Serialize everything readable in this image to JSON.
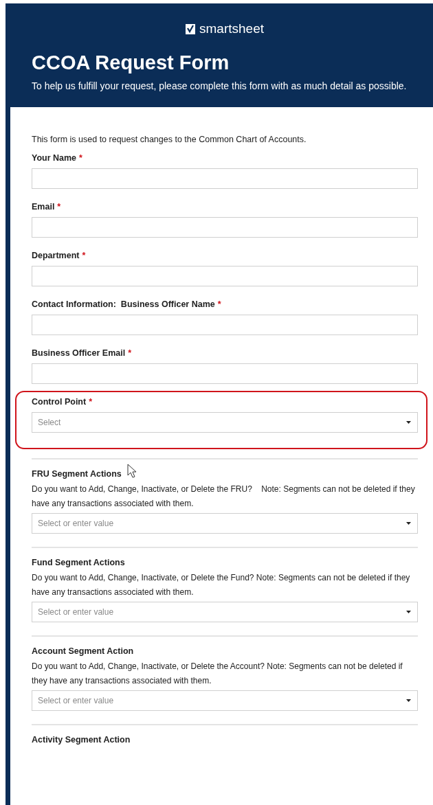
{
  "header": {
    "brand": "smartsheet",
    "title": "CCOA Request Form",
    "subtitle": "To help us fulfill your request, please complete this form with as much detail as possible."
  },
  "intro": "This form is used to request changes to the Common Chart of Accounts.",
  "fields": [
    {
      "label": "Your Name",
      "required_mark": "*",
      "kind": "text",
      "divider": false,
      "highlighted": false
    },
    {
      "label": "Email",
      "required_mark": "*",
      "kind": "text",
      "divider": false,
      "highlighted": false
    },
    {
      "label": "Department",
      "required_mark": "*",
      "kind": "text",
      "divider": false,
      "highlighted": false
    },
    {
      "label": "Contact Information:  Business Officer Name",
      "required_mark": "*",
      "kind": "text",
      "divider": false,
      "highlighted": false
    },
    {
      "label": "Business Officer Email",
      "required_mark": "*",
      "kind": "text",
      "divider": false,
      "highlighted": false
    },
    {
      "label": "Control Point",
      "required_mark": "*",
      "kind": "select",
      "placeholder": "Select",
      "divider": false,
      "highlighted": true
    },
    {
      "label": "FRU Segment Actions",
      "kind": "select",
      "description": "Do you want to Add, Change, Inactivate, or Delete the FRU?    Note: Segments can not be deleted if they have any transactions associated with them.",
      "placeholder": "Select or enter value",
      "divider": true,
      "highlighted": false
    },
    {
      "label": "Fund Segment Actions",
      "kind": "select",
      "description": "Do you want to Add, Change, Inactivate, or Delete the Fund? Note: Segments can not be deleted if they have any transactions associated with them.",
      "placeholder": "Select or enter value",
      "divider": true,
      "highlighted": false
    },
    {
      "label": "Account Segment Action",
      "kind": "select",
      "description": "Do you want to Add, Change, Inactivate, or Delete the Account? Note: Segments can not be deleted if they have any transactions associated with them.",
      "placeholder": "Select or enter value",
      "divider": true,
      "highlighted": false
    },
    {
      "label": "Activity Segment Action",
      "kind": "none",
      "divider": true,
      "highlighted": false
    }
  ]
}
